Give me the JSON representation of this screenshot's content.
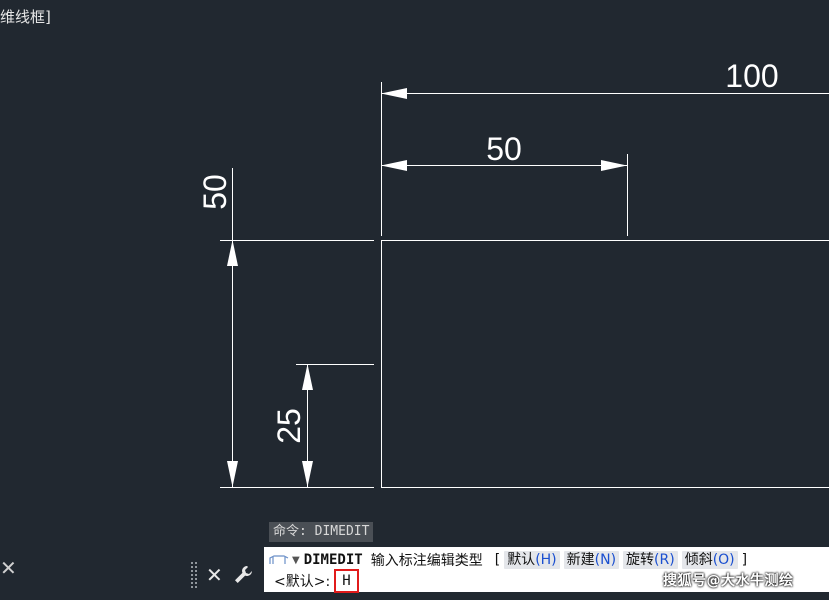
{
  "viewport": {
    "label": "维线框]",
    "dimensions": {
      "top_overall": "100",
      "top_partial": "50",
      "left_top": "50",
      "left_inner": "25"
    }
  },
  "command": {
    "history": "命令: DIMEDIT",
    "name": "DIMEDIT",
    "prompt": "输入标注编辑类型",
    "open_bracket": "[",
    "close_bracket": "]",
    "options": [
      {
        "label": "默认",
        "key": "(H)"
      },
      {
        "label": "新建",
        "key": "(N)"
      },
      {
        "label": "旋转",
        "key": "(R)"
      },
      {
        "label": "倾斜",
        "key": "(O)"
      }
    ],
    "default_prompt": "<默认>:",
    "input_value": "H"
  },
  "watermark": "搜狐号@大水牛测绘",
  "colors": {
    "background": "#212830",
    "geometry": "#ffffff",
    "highlight": "#e11b1b",
    "option_key": "#1a4fd0"
  },
  "icons": [
    "close-icon",
    "wrench-icon",
    "grip-icon",
    "command-icon",
    "dropdown-icon"
  ]
}
